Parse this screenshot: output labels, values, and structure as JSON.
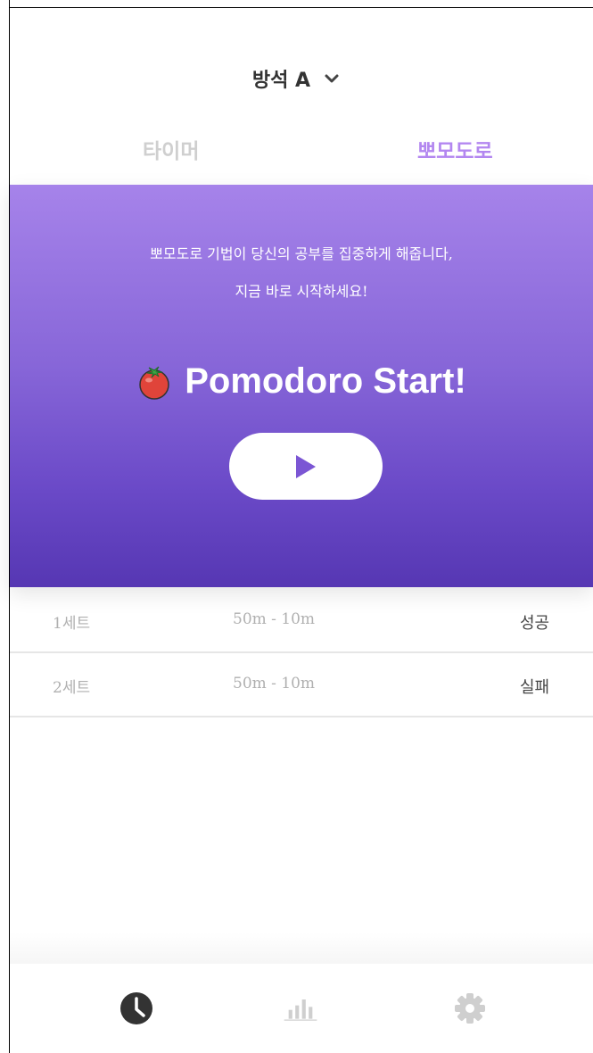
{
  "header": {
    "room_label": "방석 A",
    "dropdown_icon": "chevron-down-icon"
  },
  "tabs": [
    {
      "label": "타이머",
      "active": false
    },
    {
      "label": "뽀모도로",
      "active": true
    }
  ],
  "hero": {
    "line1": "뽀모도로 기법이 당신의 공부를 집중하게 해줍니다,",
    "line2": "지금 바로 시작하세요!",
    "title": "Pomodoro Start!",
    "title_icon": "tomato-icon",
    "play_icon": "play-icon"
  },
  "sets": [
    {
      "name": "1세트",
      "time": "50m -  10m",
      "status": "성공"
    },
    {
      "name": "2세트",
      "time": "50m -  10m",
      "status": "실패"
    }
  ],
  "bottom_nav": [
    {
      "icon": "clock-icon",
      "active": true
    },
    {
      "icon": "bar-chart-icon",
      "active": false
    },
    {
      "icon": "gear-icon",
      "active": false
    }
  ],
  "colors": {
    "accent": "#b387f0",
    "hero_top": "#a683ea",
    "hero_bottom": "#5637b3",
    "tomato": "#e0443a"
  }
}
